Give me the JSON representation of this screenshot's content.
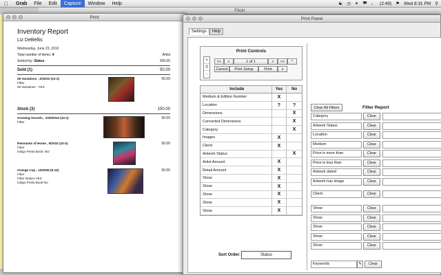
{
  "menubar": {
    "items": [
      "Grab",
      "File",
      "Edit",
      "Capture",
      "Window",
      "Help"
    ],
    "battery": "(2:49)",
    "clock": "Wed 8:31 PM"
  },
  "flickr_window": {
    "title": "Flickr"
  },
  "print_window": {
    "title": "Print",
    "report_title": "Inventory Report",
    "author": "Liz DeBellis",
    "date": "Wednesday, June 23, 2010",
    "total_label": "Total number of items:",
    "total_value": "4",
    "sorted_label": "Sorted by:",
    "sorted_value": "Status",
    "col_artist": "Artist",
    "artist_amount": "200.00",
    "sections": [
      {
        "name": "Sold (1)",
        "amount": "50.00",
        "items": [
          {
            "name": "28 Variations , 3/15/10 (10-2)",
            "details": [
              "Fiber",
              "28 Variations - YES"
            ],
            "price": "50.00"
          }
        ]
      },
      {
        "name": "Stock (3)",
        "amount": "150.00",
        "items": [
          {
            "name": "Growing Vessels , 1/30/2010 (10-1)",
            "details": [
              "Fiber"
            ],
            "price": "50.00"
          },
          {
            "name": "Remnants of Home , 6/2010 (10-3)",
            "details": [
              "Fiber",
              "Indigo Press Book: NO"
            ],
            "price": "50.00"
          },
          {
            "name": "Orange Cup , 13/2009 (9-10)",
            "details": [
              "Fiber",
              "Fiber Notion-YES",
              "Indigo Press Book-No"
            ],
            "price": "50.00"
          }
        ]
      }
    ]
  },
  "print_panel": {
    "title": "Print Panel",
    "tabs": [
      "Settings",
      "Help"
    ],
    "controls": {
      "title": "Print Controls",
      "spinner": [
        "+",
        "0",
        "-"
      ],
      "nav": [
        "<<",
        "<",
        "1 of 1",
        ">",
        ">>",
        "^"
      ],
      "actions": [
        "Cancel",
        "Print Setup",
        "Print",
        "v"
      ]
    },
    "include": {
      "headers": [
        "Include",
        "Yes",
        "No"
      ],
      "rows": [
        {
          "label": "Medium & Edition Number",
          "yes": "X",
          "no": ""
        },
        {
          "label": "Location",
          "yes": "?",
          "no": "?"
        },
        {
          "label": "Dimensions",
          "yes": "",
          "no": "X"
        },
        {
          "label": "Converted Dimensions",
          "yes": "",
          "no": "X"
        },
        {
          "label": "Category",
          "yes": "",
          "no": "X"
        },
        {
          "label": "Images",
          "yes": "X",
          "no": ""
        },
        {
          "label": "Client",
          "yes": "X",
          "no": ""
        },
        {
          "label": "Artwork Status",
          "yes": "",
          "no": "X"
        },
        {
          "label": "Artist Amount",
          "yes": "X",
          "no": ""
        },
        {
          "label": "Retail Amount",
          "yes": "X",
          "no": ""
        },
        {
          "label": "Show",
          "yes": "X",
          "no": ""
        },
        {
          "label": "Show",
          "yes": "X",
          "no": ""
        },
        {
          "label": "Show",
          "yes": "X",
          "no": ""
        },
        {
          "label": "Show",
          "yes": "X",
          "no": ""
        },
        {
          "label": "Show",
          "yes": "X",
          "no": ""
        }
      ]
    },
    "sort_label": "Sort Order:",
    "sort_value": "Status",
    "filter": {
      "clear_all": "Clear All Filters",
      "title": "Filter Report",
      "clear_label": "Clear",
      "rows_top": [
        "Category",
        "Artwork Status",
        "Location",
        "Medium",
        "Price is more than",
        "Price is less than",
        "Artwork dated",
        "Artwork has image"
      ],
      "client": "Client",
      "rows_show": [
        "Show",
        "Show",
        "Show",
        "Show",
        "Show"
      ],
      "keywords": "Keywords"
    }
  }
}
